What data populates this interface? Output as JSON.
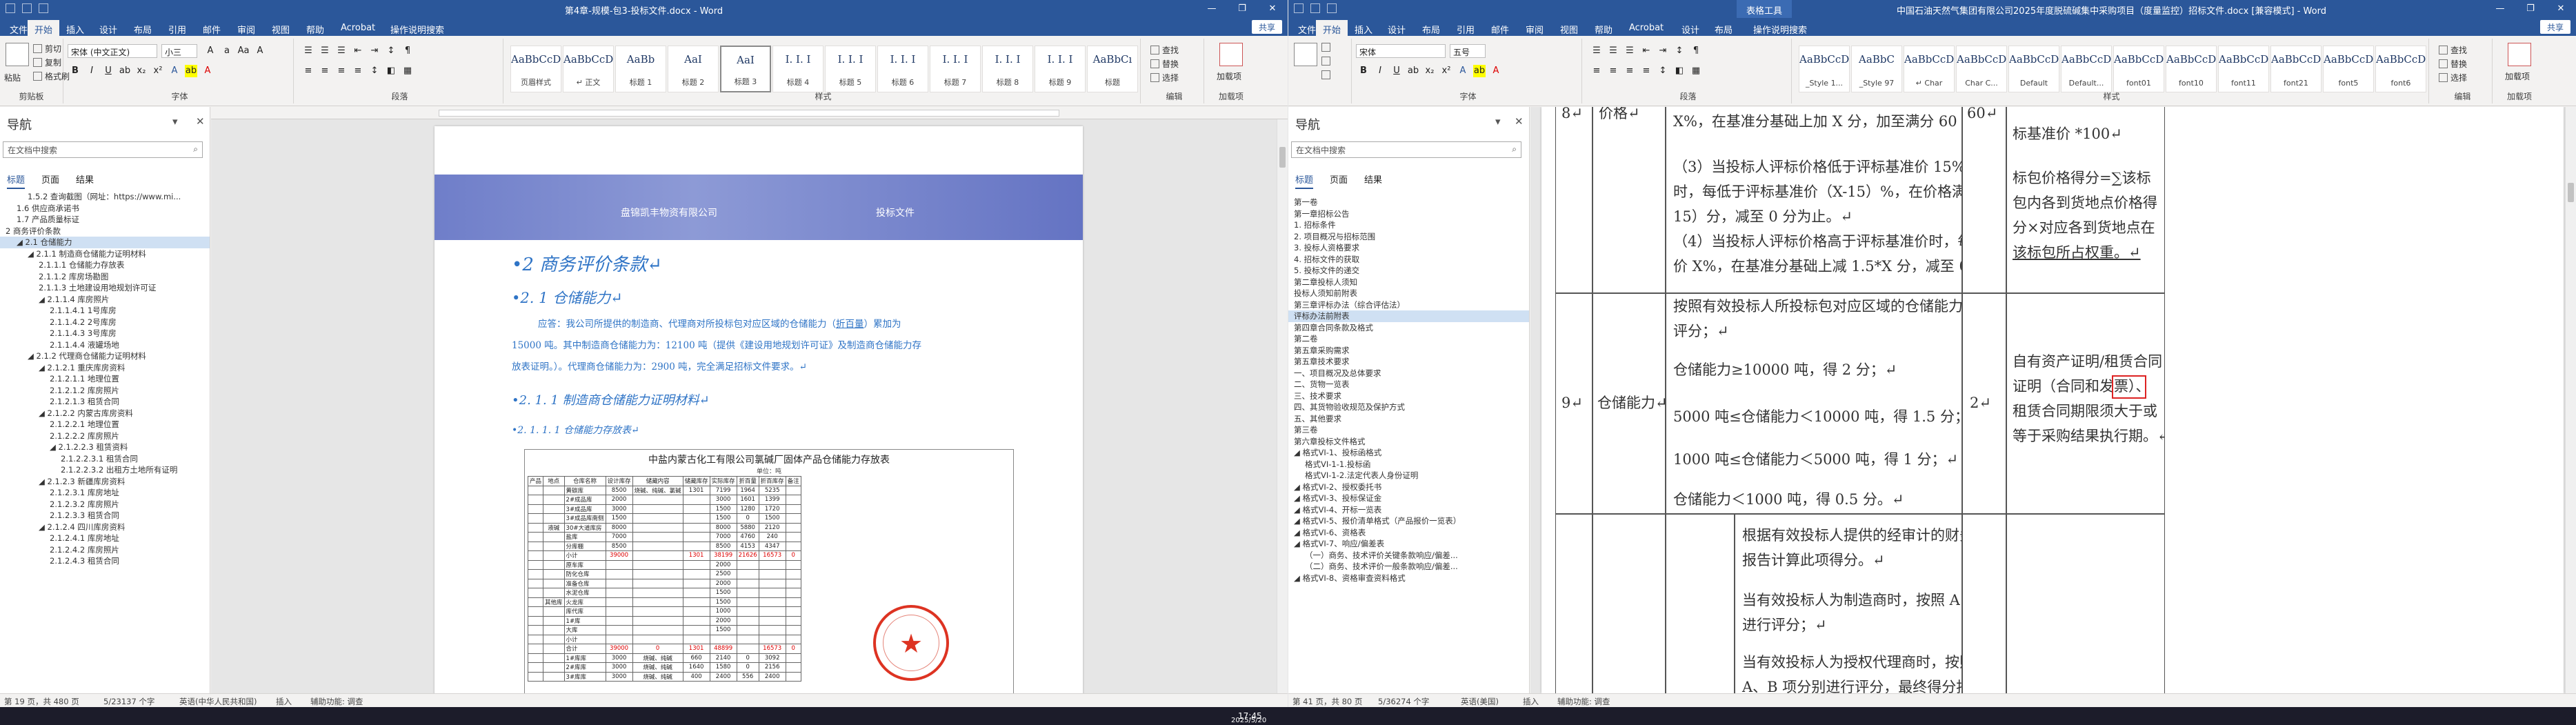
{
  "left": {
    "titlebar": {
      "title": "第4章-规模-包3-投标文件.docx - Word",
      "controls": [
        "—",
        "❐",
        "✕"
      ]
    },
    "tabs": [
      "文件",
      "开始",
      "插入",
      "设计",
      "布局",
      "引用",
      "邮件",
      "审阅",
      "视图",
      "帮助",
      "Acrobat",
      "操作说明搜索"
    ],
    "share": "共享",
    "ribbon": {
      "clipboard": {
        "label": "剪贴板",
        "paste": "粘贴",
        "cut": "剪切",
        "copy": "复制",
        "painter": "格式刷"
      },
      "font": {
        "label": "字体",
        "name": "宋体 (中文正文)",
        "size": "小三"
      },
      "paragraph": {
        "label": "段落"
      },
      "styles": {
        "label": "样式",
        "items": [
          {
            "preview": "AaBbCcDı",
            "name": "页眉样式"
          },
          {
            "preview": "AaBbCcDı",
            "name": "↵ 正文"
          },
          {
            "preview": "AaBb",
            "name": "标题 1"
          },
          {
            "preview": "AaI",
            "name": "标题 2"
          },
          {
            "preview": "AaI",
            "name": "标题 3"
          },
          {
            "preview": "I. I. I",
            "name": "标题 4"
          },
          {
            "preview": "I. I. I",
            "name": "标题 5"
          },
          {
            "preview": "I. I. I",
            "name": "标题 6"
          },
          {
            "preview": "I. I. I",
            "name": "标题 7"
          },
          {
            "preview": "I. I. I",
            "name": "标题 8"
          },
          {
            "preview": "I. I. I",
            "name": "标题 9"
          },
          {
            "preview": "AaBbCı",
            "name": "标题"
          }
        ]
      },
      "editing": {
        "label": "编辑",
        "find": "查找",
        "replace": "替换",
        "select": "选择"
      },
      "addin": {
        "label": "加载项",
        "btn": "加载项"
      }
    },
    "nav": {
      "title": "导航",
      "search_placeholder": "在文档中搜索",
      "tabs": [
        "标题",
        "页面",
        "结果"
      ],
      "items": [
        {
          "text": "1.5.2 查询截图（网址：https://www.mi...",
          "indent": 2
        },
        {
          "text": "1.6 供应商承诺书",
          "indent": 1
        },
        {
          "text": "1.7 产品质量标证",
          "indent": 1
        },
        {
          "text": "2 商务评价条款",
          "indent": 0
        },
        {
          "text": "◢ 2.1 仓储能力",
          "indent": 1,
          "hl": true
        },
        {
          "text": "◢ 2.1.1 制造商仓储能力证明材料",
          "indent": 2
        },
        {
          "text": "2.1.1.1 仓储能力存放表",
          "indent": 3
        },
        {
          "text": "2.1.1.2 库房场勘图",
          "indent": 3
        },
        {
          "text": "2.1.1.3 土地建设用地规划许可证",
          "indent": 3
        },
        {
          "text": "◢ 2.1.1.4 库房照片",
          "indent": 3
        },
        {
          "text": "2.1.1.4.1 1号库房",
          "indent": 4
        },
        {
          "text": "2.1.1.4.2 2号库房",
          "indent": 4
        },
        {
          "text": "2.1.1.4.3 3号库房",
          "indent": 4
        },
        {
          "text": "2.1.1.4.4 液罐场地",
          "indent": 4
        },
        {
          "text": "◢ 2.1.2 代理商仓储能力证明材料",
          "indent": 2
        },
        {
          "text": "◢ 2.1.2.1 重庆库房资料",
          "indent": 3
        },
        {
          "text": "2.1.2.1.1 地理位置",
          "indent": 4
        },
        {
          "text": "2.1.2.1.2 库房照片",
          "indent": 4
        },
        {
          "text": "2.1.2.1.3 租赁合同",
          "indent": 4
        },
        {
          "text": "◢ 2.1.2.2 内蒙古库房资料",
          "indent": 3
        },
        {
          "text": "2.1.2.2.1 地理位置",
          "indent": 4
        },
        {
          "text": "2.1.2.2.2 库房照片",
          "indent": 4
        },
        {
          "text": "◢ 2.1.2.2.3 租赁资料",
          "indent": 4
        },
        {
          "text": "2.1.2.2.3.1 租赁合同",
          "indent": 5
        },
        {
          "text": "2.1.2.2.3.2 出租方土地所有证明",
          "indent": 5
        },
        {
          "text": "◢ 2.1.2.3 新疆库房资料",
          "indent": 3
        },
        {
          "text": "2.1.2.3.1 库房地址",
          "indent": 4
        },
        {
          "text": "2.1.2.3.2 库房照片",
          "indent": 4
        },
        {
          "text": "2.1.2.3.3 租赁合同",
          "indent": 4
        },
        {
          "text": "◢ 2.1.2.4 四川库房资料",
          "indent": 3
        },
        {
          "text": "2.1.2.4.1 库房地址",
          "indent": 4
        },
        {
          "text": "2.1.2.4.2 库房照片",
          "indent": 4
        },
        {
          "text": "2.1.2.4.3 租赁合同",
          "indent": 4
        }
      ]
    },
    "doc": {
      "ruler_hint": "111 111 111 111",
      "banner_company": "盘锦凯丰物资有限公司",
      "banner_title": "投标文件",
      "h2": "•2 商务评价条款↵",
      "h3": "•2. 1 仓储能力↵",
      "p1a": "应答：我公司所提供的制造商、代理商对所投标包对应区域的仓储能力（",
      "p1u": "折百量",
      "p1b": "）累加为",
      "p2": "15000 吨。其中制造商仓储能力为：12100 吨（提供《建设用地规划许可证》及制造商仓储能力存",
      "p3": "放表证明。）。代理商仓储能力为：2900 吨，完全满足招标文件要求。↵",
      "h4": "•2. 1. 1 制造商仓储能力证明材料↵",
      "h5": "•2. 1. 1. 1      仓储能力存放表↵",
      "sheet": {
        "title": "中盐内蒙古化工有限公司氯碱厂固体产品仓储能力存放表",
        "unit": "单位：吨",
        "headers": [
          "产品",
          "地点",
          "仓库名称",
          "设计库存",
          "储藏内容",
          "储藏库存",
          "实际库存",
          "折百量",
          "折百库存",
          "备注"
        ],
        "rows": [
          [
            "",
            "",
            "黄碳库",
            "8500",
            "烧碱、纯碱、氯碱",
            "1301",
            "7199",
            "1964",
            "5235",
            ""
          ],
          [
            "",
            "",
            "2#成品库",
            "2000",
            "",
            "",
            "3000",
            "1601",
            "1399",
            ""
          ],
          [
            "",
            "",
            "3#成品库",
            "3000",
            "",
            "",
            "1500",
            "1280",
            "1720",
            ""
          ],
          [
            "",
            "",
            "3#成品库南侧",
            "1500",
            "",
            "",
            "1500",
            "0",
            "1500",
            ""
          ],
          [
            "",
            "液碱",
            "30#大道库房",
            "8000",
            "",
            "",
            "8000",
            "5880",
            "2120",
            ""
          ],
          [
            "",
            "",
            "盐库",
            "7000",
            "",
            "",
            "7000",
            "4760",
            "240",
            ""
          ],
          [
            "",
            "",
            "分库棚",
            "8500",
            "",
            "",
            "8500",
            "4153",
            "4347",
            ""
          ],
          [
            "",
            "",
            "小计",
            "39000",
            "",
            "1301",
            "38199",
            "21626",
            "16573",
            "0"
          ],
          [
            "",
            "",
            "原车库",
            "",
            "",
            "",
            "2000",
            "",
            "",
            ""
          ],
          [
            "",
            "",
            "防化仓库",
            "",
            "",
            "",
            "2500",
            "",
            "",
            ""
          ],
          [
            "",
            "",
            "准备仓库",
            "",
            "",
            "",
            "2000",
            "",
            "",
            ""
          ],
          [
            "",
            "",
            "水泥仓库",
            "",
            "",
            "",
            "1500",
            "",
            "",
            ""
          ],
          [
            "",
            "其他库",
            "火龙库",
            "",
            "",
            "",
            "1500",
            "",
            "",
            ""
          ],
          [
            "",
            "",
            "库代库",
            "",
            "",
            "",
            "1000",
            "",
            "",
            ""
          ],
          [
            "",
            "",
            "1#库",
            "",
            "",
            "",
            "2000",
            "",
            "",
            ""
          ],
          [
            "",
            "",
            "大库",
            "",
            "",
            "",
            "1500",
            "",
            "",
            ""
          ],
          [
            "",
            "",
            "小计",
            "",
            "",
            "",
            "",
            "",
            "",
            ""
          ],
          [
            "",
            "",
            "合计",
            "39000",
            "0",
            "1301",
            "48899",
            "",
            "16573",
            "0"
          ],
          [
            "",
            "",
            "1#库库",
            "3000",
            "烧碱、纯碱",
            "660",
            "2140",
            "0",
            "3092",
            ""
          ],
          [
            "",
            "",
            "2#库库",
            "3000",
            "烧碱、纯碱",
            "1640",
            "1580",
            "0",
            "2156",
            ""
          ],
          [
            "",
            "",
            "3#库库",
            "3000",
            "烧碱、纯碱",
            "400",
            "2400",
            "556",
            "2400",
            ""
          ]
        ]
      }
    },
    "status": {
      "page": "第 19 页，共 480 页",
      "words": "5/23137 个字",
      "lang": "英语(中华人民共和国)",
      "insert": "插入",
      "access": "辅助功能: 调查"
    }
  },
  "right": {
    "titlebar": {
      "title": "中国石油天然气集团有限公司2025年度脱硫碱集中采购项目（度量监控）招标文件.docx [兼容模式] - Word",
      "context_tab": "表格工具",
      "controls": [
        "—",
        "❐",
        "✕"
      ]
    },
    "tabs": [
      "文件",
      "开始",
      "插入",
      "设计",
      "布局",
      "引用",
      "邮件",
      "审阅",
      "视图",
      "帮助",
      "Acrobat",
      "设计",
      "布局",
      "操作说明搜索"
    ],
    "share": "共享",
    "ribbon": {
      "font": {
        "label": "字体",
        "name": "宋体",
        "size": "五号"
      },
      "paragraph": {
        "label": "段落"
      },
      "styles": {
        "label": "样式",
        "items": [
          {
            "preview": "AaBbCcDı",
            "name": "_Style 1..."
          },
          {
            "preview": "AaBbC",
            "name": "_Style 97"
          },
          {
            "preview": "AaBbCcDı",
            "name": "↵ Char"
          },
          {
            "preview": "AaBbCcDı",
            "name": "Char C..."
          },
          {
            "preview": "AaBbCcDı",
            "name": "Default"
          },
          {
            "preview": "AaBbCcDı",
            "name": "Default..."
          },
          {
            "preview": "AaBbCcDı",
            "name": "font01"
          },
          {
            "preview": "AaBbCcDı",
            "name": "font10"
          },
          {
            "preview": "AaBbCcDı",
            "name": "font11"
          },
          {
            "preview": "AaBbCcDı",
            "name": "font21"
          },
          {
            "preview": "AaBbCcDı",
            "name": "font5"
          },
          {
            "preview": "AaBbCcDı",
            "name": "font6"
          }
        ]
      },
      "editing": {
        "label": "编辑",
        "find": "查找",
        "replace": "替换",
        "select": "选择"
      },
      "addin": {
        "label": "加载项",
        "btn": "加载项"
      }
    },
    "nav": {
      "title": "导航",
      "search_placeholder": "在文档中搜索",
      "tabs": [
        "标题",
        "页面",
        "结果"
      ],
      "items": [
        {
          "text": "第一卷",
          "indent": 0
        },
        {
          "text": "第一章招标公告",
          "indent": 0
        },
        {
          "text": "1. 招标条件",
          "indent": 0
        },
        {
          "text": "2. 项目概况与招标范围",
          "indent": 0
        },
        {
          "text": "3. 投标人资格要求",
          "indent": 0
        },
        {
          "text": "4. 招标文件的获取",
          "indent": 0
        },
        {
          "text": "5. 投标文件的递交",
          "indent": 0
        },
        {
          "text": "第二章投标人须知",
          "indent": 0
        },
        {
          "text": "投标人须知前附表",
          "indent": 0
        },
        {
          "text": "第三章评标办法（综合评估法）",
          "indent": 0
        },
        {
          "text": "评标办法前附表",
          "indent": 0,
          "hl": true
        },
        {
          "text": "第四章合同条款及格式",
          "indent": 0
        },
        {
          "text": "第二卷",
          "indent": 0
        },
        {
          "text": "第五章采购需求",
          "indent": 0
        },
        {
          "text": "第五章技术要求",
          "indent": 0
        },
        {
          "text": "一、项目概况及总体要求",
          "indent": 0
        },
        {
          "text": "二、货物一览表",
          "indent": 0
        },
        {
          "text": "三、技术要求",
          "indent": 0
        },
        {
          "text": "四、其货物验收规范及保护方式",
          "indent": 0
        },
        {
          "text": "五、其他要求",
          "indent": 0
        },
        {
          "text": "第三卷",
          "indent": 0
        },
        {
          "text": "第六章投标文件格式",
          "indent": 0
        },
        {
          "text": "◢ 格式VI-1、投标函格式",
          "indent": 0
        },
        {
          "text": "格式VI-1-1.投标函",
          "indent": 1
        },
        {
          "text": "格式VI-1-2.法定代表人身份证明",
          "indent": 1
        },
        {
          "text": "◢ 格式VI-2、授权委托书",
          "indent": 0
        },
        {
          "text": "◢ 格式VI-3、投标保证金",
          "indent": 0
        },
        {
          "text": "◢ 格式VI-4、开标一览表",
          "indent": 0
        },
        {
          "text": "◢ 格式VI-5、报价清单格式（产品报价一览表）",
          "indent": 0
        },
        {
          "text": "◢ 格式VI-6、资格表",
          "indent": 0
        },
        {
          "text": "◢ 格式VI-7、响应/偏差表",
          "indent": 0
        },
        {
          "text": "（一）商务、技术评价关键条款响应/偏差...",
          "indent": 1
        },
        {
          "text": "（二）商务、技术评价一般条款响应/偏差...",
          "indent": 1
        },
        {
          "text": "◢ 格式VI-8、资格审查资料格式",
          "indent": 0
        }
      ]
    },
    "doc": {
      "row8": {
        "no": "8↵",
        "item": "价格↵",
        "lines": [
          "X%，在基准分基础上加 X 分，加至满分 60 分为止；↵",
          "",
          "（3）当投标人评标价格低于评标基准价 15%以上（不含 15%）",
          "时，每低于评标基准价（X-15）%，在价格满分基础上减（X-",
          "15）分，减至 0 分为止。↵",
          "（4）当投标人评标价格高于评标基准价时，每 高于评标基准",
          "价 X%，在基准分基础上减 1.5*X 分，减至 0 分为止。↵"
        ],
        "score": "60↵",
        "note": [
          "标基准价 *100↵",
          "",
          "标包价格得分=∑该标",
          "包内各到货地点价格得",
          "分×对应各到货地点在",
          "该标包所占权重。↵"
        ]
      },
      "row9": {
        "no": "9↵",
        "item": "仓储能力↵",
        "lines": [
          "按照有效投标人所投标包对应区域的仓储能力（折百量）进行",
          "评分；↵",
          "仓储能力≥10000 吨，得 2 分；↵",
          "5000 吨≤仓储能力＜10000 吨，得 1.5 分；↵",
          "1000 吨≤仓储能力＜5000 吨，得 1 分；↵",
          "仓储能力＜1000 吨，得 0.5 分。↵"
        ],
        "score": "2↵",
        "note": [
          "自有资产证明/租赁合同",
          "证明（合同和发票）、",
          "租赁合同期限须大于或",
          "等于采购结果执行期。↵"
        ],
        "highlight": "发票"
      },
      "row10": {
        "lines": [
          "根据有效投标人提供的经审计的财务",
          "报告计算此项得分。↵",
          "当有效投标人为制造商时，按照 A 项",
          "进行评分；↵",
          "当有效投标人为授权代理商时，按照",
          "A、B 项分别进行评分，最终得分按 A"
        ]
      }
    },
    "status": {
      "page": "第 41 页，共 80 页",
      "words": "5/36274 个字",
      "lang": "英语(美国)",
      "insert": "插入",
      "access": "辅助功能: 调查"
    }
  },
  "taskbar": {
    "time": "17:45",
    "date": "2025/5/20"
  },
  "colors": {
    "word_blue": "#2b579a",
    "heading_blue": "#2f74c6",
    "stamp_red": "#d32222",
    "nav_highlight": "#cfe0f3"
  }
}
